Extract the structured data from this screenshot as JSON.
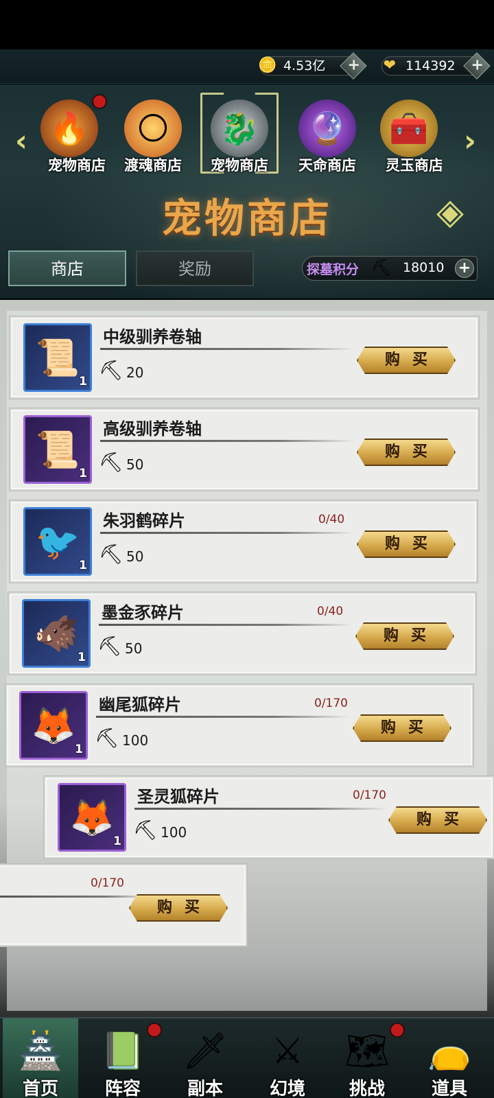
{
  "currencies": [
    {
      "icon": "coin-icon",
      "value": "4.53亿"
    },
    {
      "icon": "gem-heart-icon",
      "value": "114392"
    }
  ],
  "shop_tabs": [
    {
      "label": "宠物商店",
      "icon": "flame-spirit-icon",
      "badge": true
    },
    {
      "label": "渡魂商店",
      "icon": "soul-orb-icon",
      "badge": false
    },
    {
      "label": "宠物商店",
      "icon": "white-beast-icon",
      "badge": false,
      "selected": true
    },
    {
      "label": "天命商店",
      "icon": "purple-gem-icon",
      "badge": false
    },
    {
      "label": "灵玉商店",
      "icon": "treasure-chest-icon",
      "badge": false
    }
  ],
  "shop_title": "宠物商店",
  "sub_tabs": {
    "shop": "商店",
    "reward": "奖励"
  },
  "score": {
    "label": "探墓积分",
    "value": "18010"
  },
  "buy_label": "购买",
  "items": [
    {
      "name": "中级驯养卷轴",
      "price": "20",
      "count": "1",
      "progress": "",
      "rarity": "blue",
      "icon": "scroll-icon"
    },
    {
      "name": "高级驯养卷轴",
      "price": "50",
      "count": "1",
      "progress": "",
      "rarity": "purple",
      "icon": "scroll-icon"
    },
    {
      "name": "朱羽鹤碎片",
      "price": "50",
      "count": "1",
      "progress": "0/40",
      "rarity": "blue",
      "icon": "red-crane-icon"
    },
    {
      "name": "墨金豕碎片",
      "price": "50",
      "count": "1",
      "progress": "0/40",
      "rarity": "blue",
      "icon": "armored-boar-icon"
    },
    {
      "name": "幽尾狐碎片",
      "price": "100",
      "count": "1",
      "progress": "0/170",
      "rarity": "purple",
      "icon": "white-fox-icon"
    },
    {
      "name": "圣灵狐碎片",
      "price": "100",
      "count": "1",
      "progress": "0/170",
      "rarity": "purple",
      "icon": "spirit-fox-icon"
    },
    {
      "name": "",
      "price": "",
      "count": "",
      "progress": "0/170",
      "rarity": "purple",
      "icon": ""
    }
  ],
  "bottom_nav": [
    {
      "label": "首页",
      "icon": "pagoda-icon",
      "active": true,
      "badge": false
    },
    {
      "label": "阵容",
      "icon": "book-icon",
      "active": false,
      "badge": true
    },
    {
      "label": "副本",
      "icon": "sword-icon",
      "active": false,
      "badge": false
    },
    {
      "label": "幻境",
      "icon": "crossed-swords-icon",
      "active": false,
      "badge": false
    },
    {
      "label": "挑战",
      "icon": "scroll-map-icon",
      "active": false,
      "badge": true
    },
    {
      "label": "道具",
      "icon": "bag-icon",
      "active": false,
      "badge": false
    }
  ]
}
